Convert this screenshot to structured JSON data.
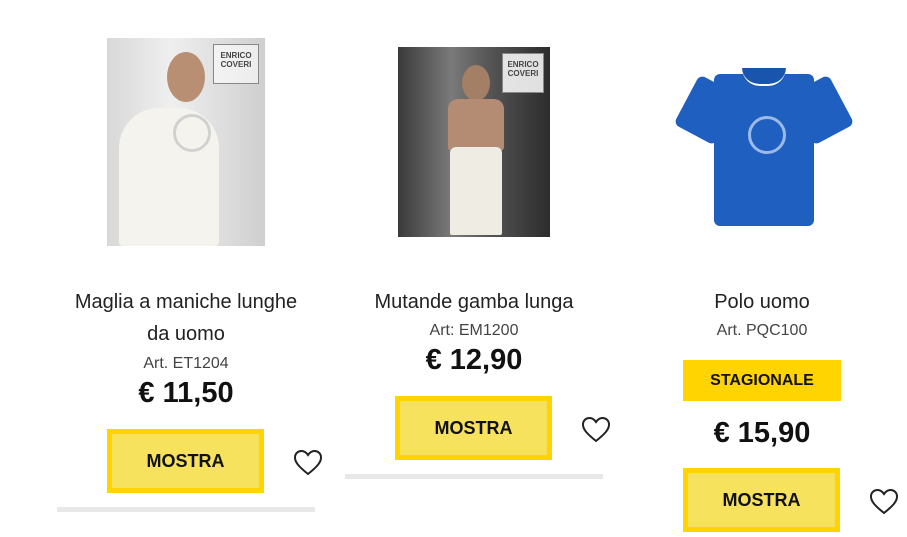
{
  "products": [
    {
      "title_line1": "Maglia a maniche lunghe",
      "title_line2": "da uomo",
      "article": "Art. ET1204",
      "price": "€ 11,50",
      "button_label": "MOSTRA",
      "brand_tag": "ENRICO COVERI"
    },
    {
      "title_line1": "Mutande gamba lunga",
      "article": "Art: EM1200",
      "price": "€ 12,90",
      "button_label": "MOSTRA",
      "brand_tag": "ENRICO COVERI"
    },
    {
      "title_line1": "Polo uomo",
      "article": "Art. PQC100",
      "badge": "STAGIONALE",
      "price": "€ 15,90",
      "button_label": "MOSTRA"
    }
  ],
  "colors": {
    "accent": "#ffd400",
    "button_fill": "#f7e25e",
    "polo_blue": "#1f5fbf"
  },
  "icons": {
    "wishlist": "heart-outline-icon"
  }
}
